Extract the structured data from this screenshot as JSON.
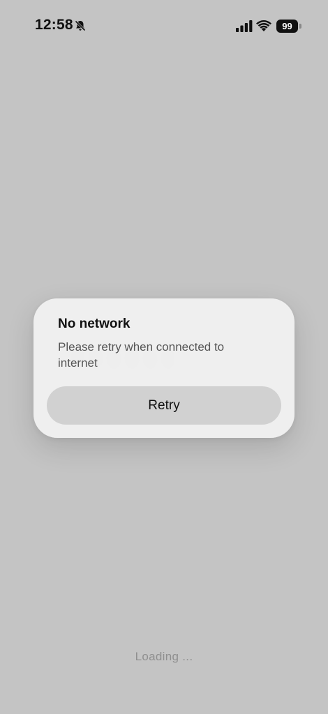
{
  "status_bar": {
    "time": "12:58",
    "battery_level": "99",
    "icons": [
      "bell-slash-icon",
      "cellular-signal-icon",
      "wifi-icon",
      "battery-icon"
    ]
  },
  "dialog": {
    "title": "No network",
    "message": "Please retry when connected to internet",
    "retry_label": "Retry"
  },
  "loading": {
    "text": "Loading ..."
  },
  "colors": {
    "background": "#c4c4c4",
    "dialog_background": "#f0f0f0",
    "button_background": "#d1d1d1",
    "title_text": "#111111",
    "message_text": "#555555",
    "loading_text": "#8f8f8f"
  }
}
